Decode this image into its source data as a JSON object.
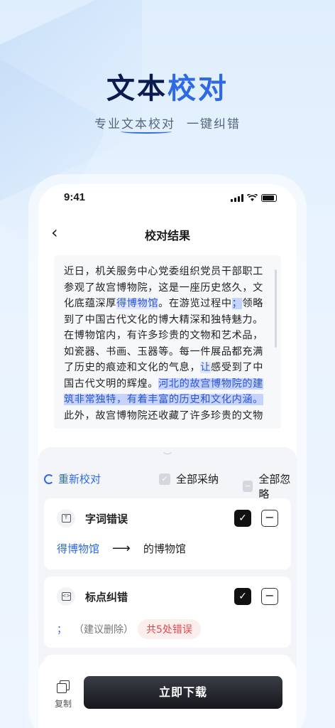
{
  "hero": {
    "title_a": "文本",
    "title_b": "校对",
    "subtitle_a": "专业文本校对",
    "subtitle_b": "一键纠错"
  },
  "status": {
    "time": "9:41"
  },
  "nav": {
    "title": "校对结果"
  },
  "doc": {
    "p1": "近日，机关服务中心党委组织党员干部职工参观了故宫博物院，这是一座历史悠久，文化底蕴深厚",
    "h1": "得博物馆",
    "p2": "。在游览过程中",
    "h2": "；",
    "p3": "领略到了中国古代文化的博大精深和独特魅力。在博物馆内，有许多珍贵的文物和艺术品，如瓷器、书画、玉器等。每一件展品都充满了历史的痕迹和文化的气息，",
    "h3": "让",
    "p4": "感受到了中国古代文明的辉煌。",
    "h4": "河北的故宫博物院的建筑非常独特，有着丰富的历史和文化内涵。",
    "p5": "此外，故宫博物院还收藏了许多珍贵的文物"
  },
  "actions": {
    "recheck": "重新校对",
    "adopt_all": "全部采纳",
    "ignore_all": "全部忽略"
  },
  "cards": [
    {
      "title": "字词错误",
      "original": "得博物馆",
      "fixed": "的博物馆",
      "icon": "text-icon"
    },
    {
      "title": "标点纠错",
      "punct": "；",
      "suggestion": "（建议删除）",
      "badge": "共5处错误",
      "icon": "code-icon"
    }
  ],
  "footer": {
    "copy_label": "复制",
    "download_label": "立即下载"
  }
}
